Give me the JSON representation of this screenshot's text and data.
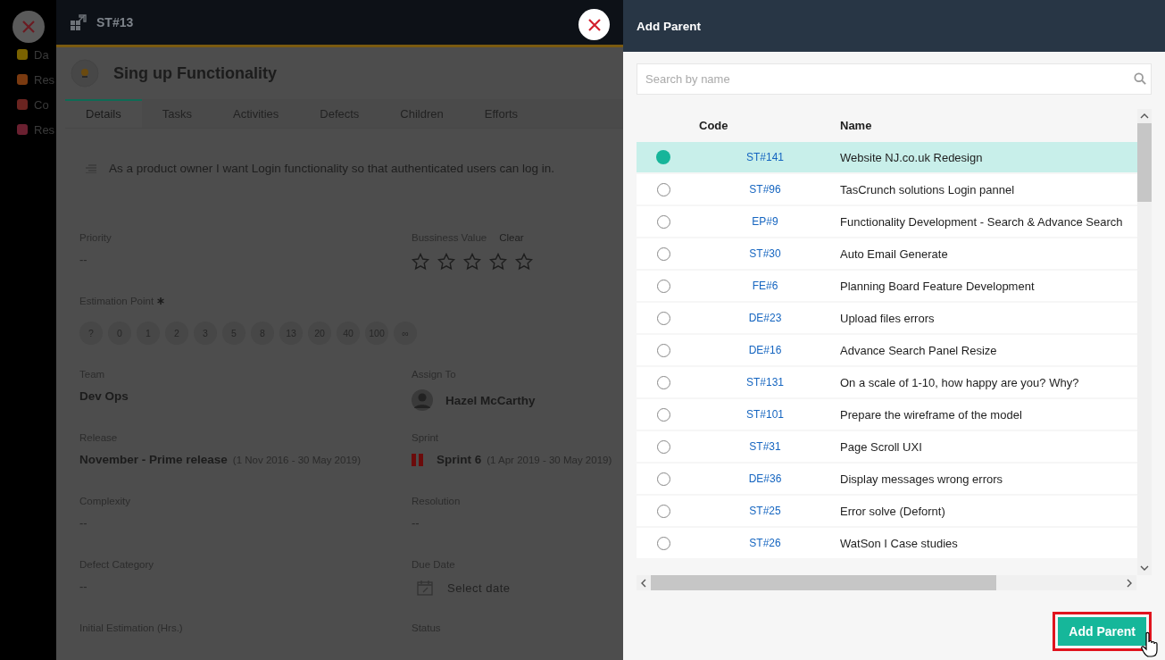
{
  "sidebar": {
    "items": [
      {
        "label": "Da",
        "color": "#7a6200"
      },
      {
        "label": "Res",
        "color": "#7a3a10"
      },
      {
        "label": "Co",
        "color": "#6a2420"
      },
      {
        "label": "Res",
        "color": "#6a2030"
      }
    ]
  },
  "story": {
    "code": "ST#13",
    "title": "Sing up Functionality",
    "tabs": [
      {
        "label": "Details",
        "selected": true
      },
      {
        "label": "Tasks",
        "selected": false
      },
      {
        "label": "Activities",
        "selected": false
      },
      {
        "label": "Defects",
        "selected": false
      },
      {
        "label": "Children",
        "selected": false
      },
      {
        "label": "Efforts",
        "selected": false
      }
    ],
    "description": "As a product owner I want Login functionality so that authenticated users can log in.",
    "fields": [
      {
        "kind": "text",
        "label": "Priority",
        "value": "--"
      },
      {
        "kind": "stars",
        "label": "Bussiness Value",
        "action": "Clear",
        "stars": 0
      },
      {
        "kind": "points",
        "label": "Estimation Point",
        "required": true,
        "options": [
          "?",
          "0",
          "1",
          "2",
          "3",
          "5",
          "8",
          "13",
          "20",
          "40",
          "100",
          "∞"
        ]
      },
      {
        "kind": "text",
        "label": "Team",
        "value": "Dev Ops"
      },
      {
        "kind": "person",
        "label": "Assign To",
        "value": "Hazel McCarthy"
      },
      {
        "kind": "range",
        "label": "Release",
        "value": "November - Prime release",
        "range": "(1 Nov 2016 - 30 May 2019)"
      },
      {
        "kind": "sprint",
        "label": "Sprint",
        "value": "Sprint 6",
        "range": "(1 Apr 2019 - 30 May 2019)"
      },
      {
        "kind": "text",
        "label": "Complexity",
        "value": "--"
      },
      {
        "kind": "text",
        "label": "Resolution",
        "value": "--"
      },
      {
        "kind": "text",
        "label": "Defect Category",
        "value": "--"
      },
      {
        "kind": "date",
        "label": "Due Date",
        "placeholder": "Select date"
      },
      {
        "kind": "label",
        "label": "Initial Estimation (Hrs.)"
      },
      {
        "kind": "label",
        "label": "Status"
      }
    ]
  },
  "dialog": {
    "title": "Add Parent",
    "search": {
      "placeholder": "Search by name"
    },
    "columns": [
      "Code",
      "Name"
    ],
    "rows": [
      {
        "code": "ST#141",
        "name": "Website NJ.co.uk Redesign",
        "selected": true
      },
      {
        "code": "ST#96",
        "name": "TasCrunch solutions Login pannel",
        "selected": false
      },
      {
        "code": "EP#9",
        "name": "Functionality Development - Search & Advance Search",
        "selected": false
      },
      {
        "code": "ST#30",
        "name": "Auto Email Generate",
        "selected": false
      },
      {
        "code": "FE#6",
        "name": "Planning Board Feature Development",
        "selected": false
      },
      {
        "code": "DE#23",
        "name": "Upload files errors",
        "selected": false
      },
      {
        "code": "DE#16",
        "name": "Advance Search Panel Resize",
        "selected": false
      },
      {
        "code": "ST#131",
        "name": "On a scale of 1-10, how happy are you? Why?",
        "selected": false
      },
      {
        "code": "ST#101",
        "name": "Prepare the wireframe of the model",
        "selected": false
      },
      {
        "code": "ST#31",
        "name": "Page Scroll UXI",
        "selected": false
      },
      {
        "code": "DE#36",
        "name": "Display messages wrong errors",
        "selected": false
      },
      {
        "code": "ST#25",
        "name": "Error solve (Defornt)",
        "selected": false
      },
      {
        "code": "ST#26",
        "name": "WatSon I Case studies",
        "selected": false
      }
    ],
    "button": "Add Parent"
  }
}
